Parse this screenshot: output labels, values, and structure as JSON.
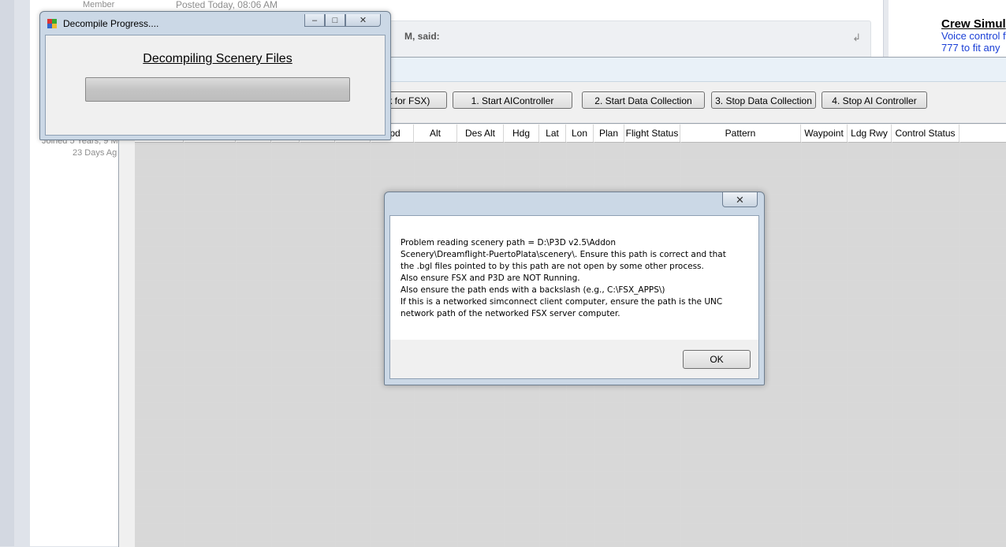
{
  "forum": {
    "member_label": "Member",
    "posted_label": "Posted Today, 08:06 AM",
    "joined_label": "Joined 5 Years, 9 M",
    "days_label": "23 Days Ag",
    "quote_said": "M, said:",
    "ad_title": "Crew Simul",
    "ad_line1": "Voice control f",
    "ad_line2": "777 to fit any"
  },
  "ai_controller": {
    "buttons": [
      {
        "label": "ick for FSX)"
      },
      {
        "label": "1. Start AIController"
      },
      {
        "label": "2. Start Data Collection"
      },
      {
        "label": "3. Stop Data Collection"
      },
      {
        "label": "4. Stop AI Controller"
      }
    ],
    "columns": [
      "Spd",
      "Alt",
      "Des Alt",
      "Hdg",
      "Lat",
      "Lon",
      "Plan",
      "Flight Status",
      "Pattern",
      "Waypoint",
      "Ldg Rwy",
      "Control Status"
    ]
  },
  "decompile_window": {
    "title": "Decompile Progress....",
    "heading": "Decompiling Scenery Files",
    "progress": 0
  },
  "message_box": {
    "lines": [
      "Problem reading scenery path = D:\\P3D v2.5\\Addon",
      "Scenery\\Dreamflight-PuertoPlata\\scenery\\. Ensure this path is correct and that",
      "the .bgl files pointed to by this path are not open by some other process.",
      "Also ensure FSX and P3D are NOT Running.",
      "Also ensure the path ends with a backslash (e.g., C:\\FSX_APPS\\)",
      "If this is a networked simconnect client computer, ensure the path is the UNC",
      "network path of the networked FSX server computer."
    ],
    "ok_label": "OK"
  },
  "icons": {
    "minimize": "minimize-icon",
    "maximize": "maximize-icon",
    "close": "close-icon",
    "app": "app-icon",
    "quote": "quote-reply-icon"
  },
  "colors": {
    "window_frame": "#cbd8e6",
    "grid_background": "#c6c6c6",
    "ad_link": "#1a3fd6"
  }
}
